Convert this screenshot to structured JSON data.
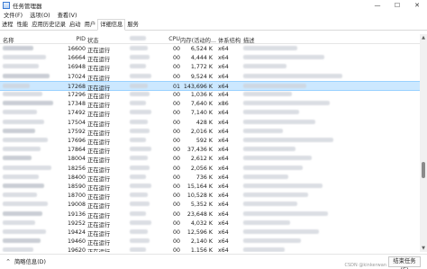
{
  "window": {
    "title": "任务管理器",
    "controls": [
      "—",
      "☐",
      "✕"
    ]
  },
  "menu": {
    "items": [
      "文件(F)",
      "选项(O)",
      "查看(V)"
    ]
  },
  "tabs": [
    "进程",
    "性能",
    "应用历史记录",
    "启动",
    "用户",
    "详细信息",
    "服务"
  ],
  "table": {
    "columns": [
      "名称",
      "PID",
      "状态",
      "",
      "CPU",
      "内存(活动的...",
      "体系结构",
      "描述"
    ],
    "rows": [
      {
        "pid": "16600",
        "status": "正在运行",
        "cpu": "00",
        "mem": "6,524 K",
        "arch": "x64"
      },
      {
        "pid": "16664",
        "status": "正在运行",
        "cpu": "00",
        "mem": "4,444 K",
        "arch": "x64"
      },
      {
        "pid": "16948",
        "status": "正在运行",
        "cpu": "00",
        "mem": "1,772 K",
        "arch": "x64"
      },
      {
        "pid": "17024",
        "status": "正在运行",
        "cpu": "00",
        "mem": "9,524 K",
        "arch": "x64"
      },
      {
        "pid": "17268",
        "status": "正在运行",
        "cpu": "01",
        "mem": "143,696 K",
        "arch": "x64"
      },
      {
        "pid": "17296",
        "status": "正在运行",
        "cpu": "00",
        "mem": "1,036 K",
        "arch": "x64"
      },
      {
        "pid": "17348",
        "status": "正在运行",
        "cpu": "00",
        "mem": "7,640 K",
        "arch": "x86"
      },
      {
        "pid": "17492",
        "status": "正在运行",
        "cpu": "00",
        "mem": "7,140 K",
        "arch": "x64"
      },
      {
        "pid": "17504",
        "status": "正在运行",
        "cpu": "00",
        "mem": "428 K",
        "arch": "x64"
      },
      {
        "pid": "17592",
        "status": "正在运行",
        "cpu": "00",
        "mem": "2,016 K",
        "arch": "x64"
      },
      {
        "pid": "17696",
        "status": "正在运行",
        "cpu": "00",
        "mem": "592 K",
        "arch": "x64"
      },
      {
        "pid": "17864",
        "status": "正在运行",
        "cpu": "00",
        "mem": "37,436 K",
        "arch": "x64"
      },
      {
        "pid": "18004",
        "status": "正在运行",
        "cpu": "00",
        "mem": "2,612 K",
        "arch": "x64"
      },
      {
        "pid": "18256",
        "status": "正在运行",
        "cpu": "00",
        "mem": "2,056 K",
        "arch": "x64"
      },
      {
        "pid": "18400",
        "status": "正在运行",
        "cpu": "00",
        "mem": "736 K",
        "arch": "x64"
      },
      {
        "pid": "18590",
        "status": "正在运行",
        "cpu": "00",
        "mem": "15,164 K",
        "arch": "x64"
      },
      {
        "pid": "18700",
        "status": "正在运行",
        "cpu": "00",
        "mem": "10,528 K",
        "arch": "x64"
      },
      {
        "pid": "19008",
        "status": "正在运行",
        "cpu": "00",
        "mem": "5,352 K",
        "arch": "x64"
      },
      {
        "pid": "19136",
        "status": "正在运行",
        "cpu": "00",
        "mem": "23,648 K",
        "arch": "x64"
      },
      {
        "pid": "19252",
        "status": "正在运行",
        "cpu": "00",
        "mem": "4,032 K",
        "arch": "x64"
      },
      {
        "pid": "19424",
        "status": "正在运行",
        "cpu": "00",
        "mem": "12,596 K",
        "arch": "x64"
      },
      {
        "pid": "19460",
        "status": "正在运行",
        "cpu": "00",
        "mem": "2,140 K",
        "arch": "x64"
      },
      {
        "pid": "19620",
        "status": "正在运行",
        "cpu": "00",
        "mem": "1,156 K",
        "arch": "x64"
      },
      {
        "pid": "19692",
        "status": "正在运行",
        "cpu": "00",
        "mem": "832 K",
        "arch": "x64"
      }
    ],
    "selected_pid": "17268"
  },
  "footer": {
    "less_details": "简略信息(D)",
    "end_task": "结束任务(E)",
    "watermark": "CSDN @kinkerwan"
  },
  "colors": {
    "selection": "#cce8ff",
    "selection_border": "#99d1ff",
    "redacted": "#cfd3da"
  },
  "icons": {
    "app": "task-manager-icon",
    "footer_toggle": "chevron-up-icon",
    "scroll_up": "scroll-up-arrow-icon",
    "scroll_down": "scroll-down-arrow-icon"
  }
}
